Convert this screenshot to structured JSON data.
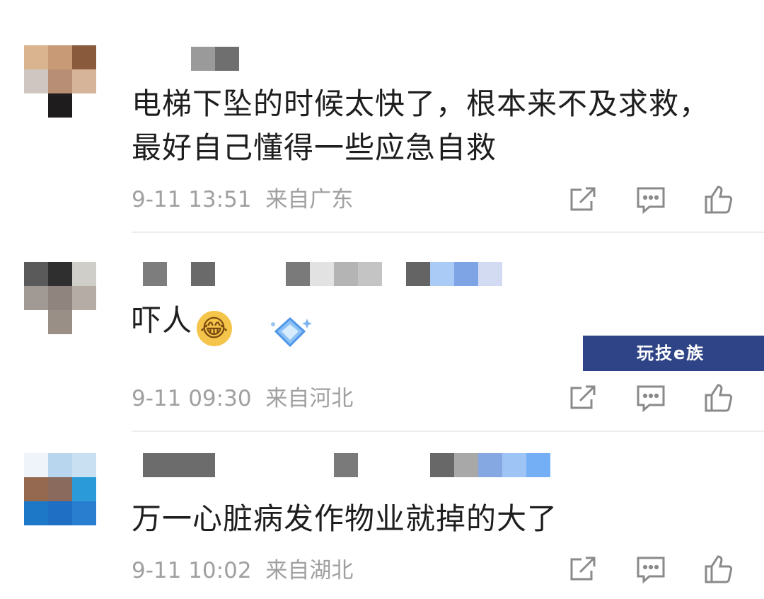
{
  "comments": [
    {
      "text": "电梯下坠的时候太快了，根本来不及求救，最好自己懂得一些应急自救",
      "time": "9-11 13:51",
      "location": "来自广东"
    },
    {
      "text": "吓人",
      "emoji": "laughing-crying-emoji",
      "time": "9-11 09:30",
      "location": "来自河北"
    },
    {
      "text": "万一心脏病发作物业就掉的大了",
      "time": "9-11 10:02",
      "location": "来自湖北"
    }
  ],
  "watermark": "玩技e族",
  "icons": {
    "share": "share-icon",
    "reply": "comment-icon",
    "like": "thumbs-up-icon"
  },
  "colors": {
    "text": "#1e1e1e",
    "meta": "#a0a0a0",
    "divider": "#ededed",
    "watermark_bg": "#2e4486"
  }
}
